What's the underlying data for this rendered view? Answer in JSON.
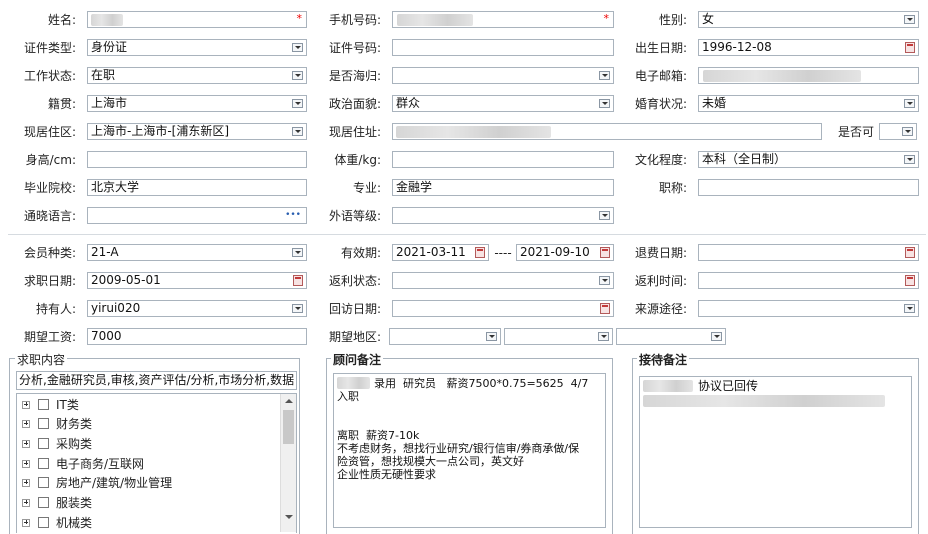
{
  "basic": {
    "name_label": "姓名:",
    "phone_label": "手机号码:",
    "gender_label": "性别:",
    "gender_value": "女",
    "id_type_label": "证件类型:",
    "id_type_value": "身份证",
    "id_no_label": "证件号码:",
    "birth_label": "出生日期:",
    "birth_value": "1996-12-08",
    "work_status_label": "工作状态:",
    "work_status_value": "在职",
    "returnee_label": "是否海归:",
    "email_label": "电子邮箱:",
    "native_label": "籍贯:",
    "native_value": "上海市",
    "political_label": "政治面貌:",
    "political_value": "群众",
    "marital_label": "婚育状况:",
    "marital_value": "未婚",
    "residence_area_label": "现居住区:",
    "residence_area_value": "上海市-上海市-[浦东新区]",
    "address_label": "现居住址:",
    "available_label": "是否可",
    "height_label": "身高/cm:",
    "weight_label": "体重/kg:",
    "education_label": "文化程度:",
    "education_value": "本科（全日制）",
    "school_label": "毕业院校:",
    "school_value": "北京大学",
    "major_label": "专业:",
    "major_value": "金融学",
    "title_label": "职称:",
    "languages_label": "通晓语言:",
    "language_more": "•••",
    "lang_level_label": "外语等级:"
  },
  "membership": {
    "member_type_label": "会员种类:",
    "member_type_value": "21-A",
    "valid_label": "有效期:",
    "valid_from": "2021-03-11",
    "valid_sep": "----",
    "valid_to": "2021-09-10",
    "refund_date_label": "退费日期:",
    "job_date_label": "求职日期:",
    "job_date_value": "2009-05-01",
    "rebate_status_label": "返利状态:",
    "rebate_time_label": "返利时间:",
    "holder_label": "持有人:",
    "holder_value": "yirui020",
    "visit_date_label": "回访日期:",
    "source_label": "来源途径:",
    "salary_label": "期望工资:",
    "salary_value": "7000",
    "region_label": "期望地区:"
  },
  "job": {
    "title": "求职内容",
    "summary": "分析,金融研究员,审核,资产评估/分析,市场分析,数据",
    "categories": [
      "IT类",
      "财务类",
      "采购类",
      "电子商务/互联网",
      "房地产/建筑/物业管理",
      "服装类",
      "机械类"
    ]
  },
  "advisor_notes": {
    "title": "顾问备注",
    "line1": "录用  研究员   薪资7500*0.75=5625  4/7",
    "line2": "入职",
    "line3": "",
    "line4": "离职  薪资7-10k",
    "line5": "不考虑财务，想找行业研究/银行信审/券商承做/保",
    "line6": "险资管，想找规模大一点公司，英文好",
    "line7": "企业性质无硬性要求"
  },
  "reception_notes": {
    "title": "接待备注",
    "line1": "协议已回传"
  }
}
